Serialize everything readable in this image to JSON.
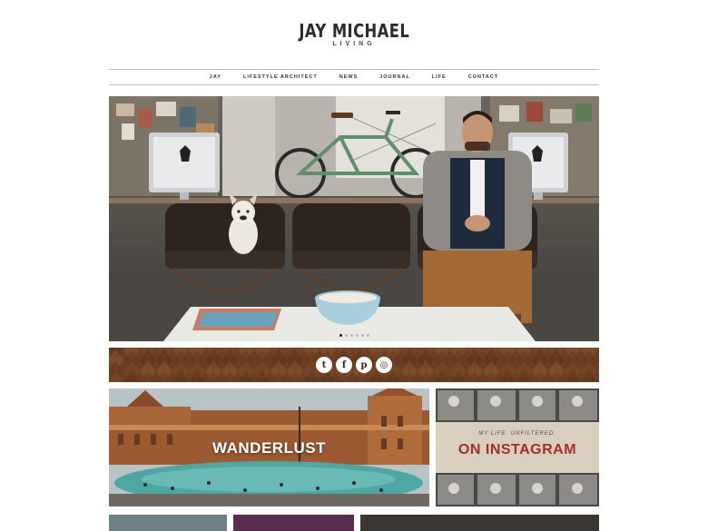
{
  "logo": {
    "title": "JAY MICHAEL",
    "subtitle": "LIVING"
  },
  "nav": {
    "items": [
      {
        "label": "JAY"
      },
      {
        "label": "LIFESTYLE ARCHITECT"
      },
      {
        "label": "NEWS"
      },
      {
        "label": "JOURNAL"
      },
      {
        "label": "LIFE"
      },
      {
        "label": "CONTACT"
      }
    ]
  },
  "hero": {
    "slide_count": 6,
    "active_slide": 1
  },
  "social": {
    "icons": [
      {
        "name": "twitter-icon",
        "glyph": "t"
      },
      {
        "name": "facebook-icon",
        "glyph": "f"
      },
      {
        "name": "pinterest-icon",
        "glyph": "p"
      },
      {
        "name": "instagram-icon",
        "glyph": "◎"
      }
    ]
  },
  "tiles": {
    "wanderlust": {
      "label": "WANDERLUST"
    },
    "instagram": {
      "tagline": "MY LIFE. UNFILTERED.",
      "title": "ON INSTAGRAM"
    }
  },
  "colors": {
    "wood": "#6b3f22",
    "instagram_red": "#a4302a",
    "nav_border": "#bcbcbc"
  }
}
